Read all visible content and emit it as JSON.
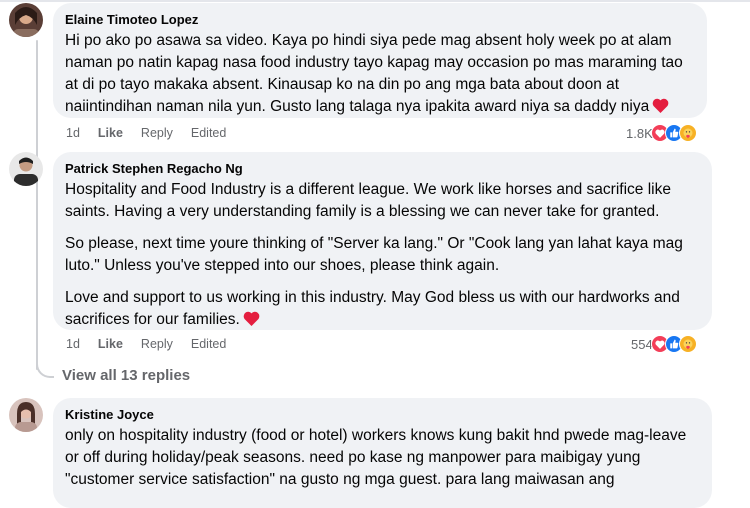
{
  "comments": [
    {
      "author": "Elaine Timoteo Lopez",
      "paragraphs": [
        "Hi po ako po asawa sa video. Kaya po hindi siya pede mag absent holy week po at alam naman po natin kapag nasa food industry tayo kapag may occasion po mas maraming tao at di po tayo makaka absent. Kinausap ko na din po ang mga bata about doon at naiintindihan naman nila yun. Gusto lang talaga nya ipakita award niya sa daddy niya"
      ],
      "time": "1d",
      "like_label": "Like",
      "reply_label": "Reply",
      "edited_label": "Edited",
      "reaction_count": "1.8K",
      "reaction_icons": [
        "love-icon",
        "like-icon",
        "care-icon"
      ]
    },
    {
      "author": "Patrick Stephen Regacho Ng",
      "paragraphs": [
        "Hospitality and Food Industry is a different league. We work like horses and sacrifice like saints. Having a very understanding family is a blessing we can never take for granted.",
        "So please, next time youre thinking of \"Server ka lang.\" Or \"Cook lang yan lahat kaya mag luto.\" Unless you've stepped into our shoes, please think again.",
        "Love and support to us working in this industry. May God bless us with our hardworks and sacrifices for our families."
      ],
      "time": "1d",
      "like_label": "Like",
      "reply_label": "Reply",
      "edited_label": "Edited",
      "reaction_count": "554",
      "reaction_icons": [
        "love-icon",
        "like-icon",
        "care-icon"
      ]
    },
    {
      "author": "Kristine Joyce",
      "paragraphs": [
        "only on hospitality industry (food or hotel) workers knows kung bakit hnd pwede mag-leave or off during holiday/peak seasons. need po kase ng manpower para maibigay yung \"customer service satisfaction\" na gusto ng mga guest. para lang maiwasan ang"
      ]
    }
  ],
  "view_replies_label": "View all 13 replies",
  "colors": {
    "bubble": "#f0f2f5",
    "secondary_text": "#65676b",
    "heart": "#e41e3f",
    "love": "#f33e58",
    "like": "#1877f2",
    "care": "#f7b125"
  }
}
